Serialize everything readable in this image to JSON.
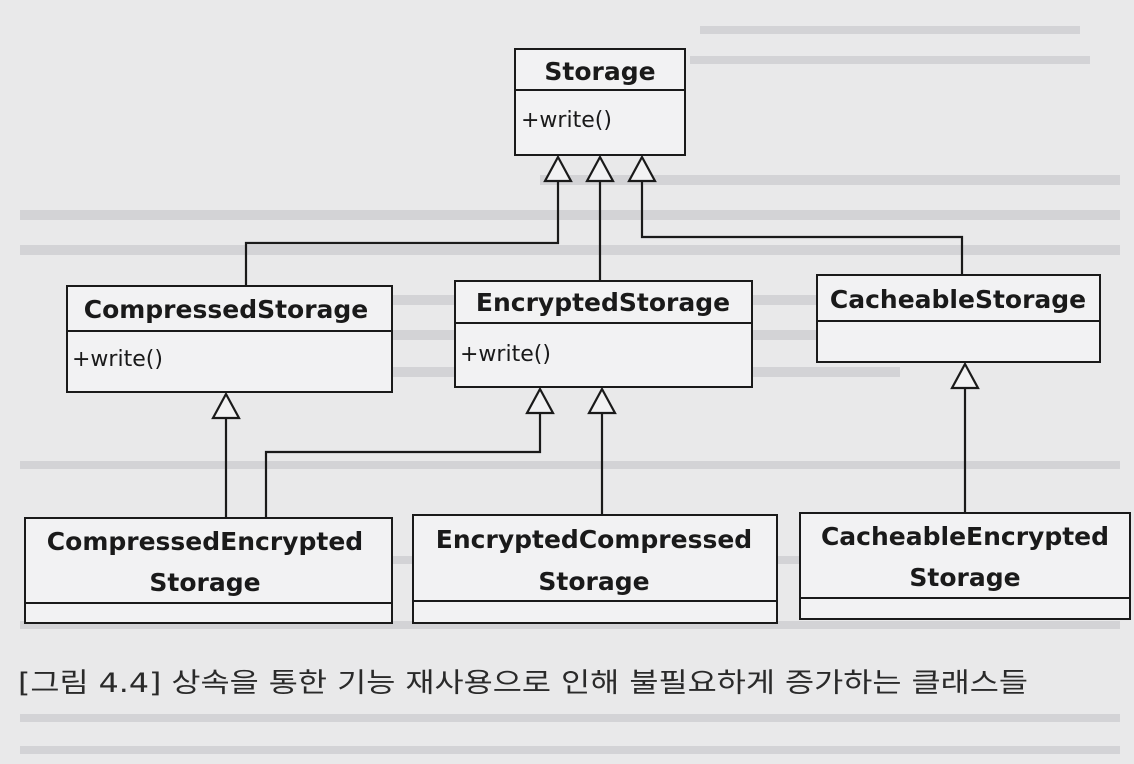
{
  "diagram": {
    "classes": {
      "storage": {
        "name": "Storage",
        "methods": [
          "+write()"
        ]
      },
      "compressed": {
        "name": "CompressedStorage",
        "methods": [
          "+write()"
        ]
      },
      "encrypted": {
        "name": "EncryptedStorage",
        "methods": [
          "+write()"
        ]
      },
      "cacheable": {
        "name": "CacheableStorage",
        "methods": []
      },
      "compressed_encrypted": {
        "name_lines": [
          "CompressedEncrypted",
          "Storage"
        ],
        "methods": []
      },
      "encrypted_compressed": {
        "name_lines": [
          "EncryptedCompressed",
          "Storage"
        ],
        "methods": []
      },
      "cacheable_encrypted": {
        "name_lines": [
          "CacheableEncrypted",
          "Storage"
        ],
        "methods": []
      }
    },
    "relations": [
      {
        "from": "CompressedStorage",
        "to": "Storage",
        "type": "inheritance"
      },
      {
        "from": "EncryptedStorage",
        "to": "Storage",
        "type": "inheritance"
      },
      {
        "from": "CacheableStorage",
        "to": "Storage",
        "type": "inheritance"
      },
      {
        "from": "CompressedEncryptedStorage",
        "to": "CompressedStorage",
        "type": "inheritance"
      },
      {
        "from": "CompressedEncryptedStorage",
        "to": "EncryptedStorage",
        "type": "inheritance"
      },
      {
        "from": "EncryptedCompressedStorage",
        "to": "EncryptedStorage",
        "type": "inheritance"
      },
      {
        "from": "CacheableEncryptedStorage",
        "to": "CacheableStorage",
        "type": "inheritance"
      }
    ]
  },
  "caption": "[그림 4.4] 상속을 통한 기능 재사용으로 인해 불필요하게 증가하는 클래스들",
  "colors": {
    "paper": "#e9e9ea",
    "ink": "#1a1a1a"
  }
}
